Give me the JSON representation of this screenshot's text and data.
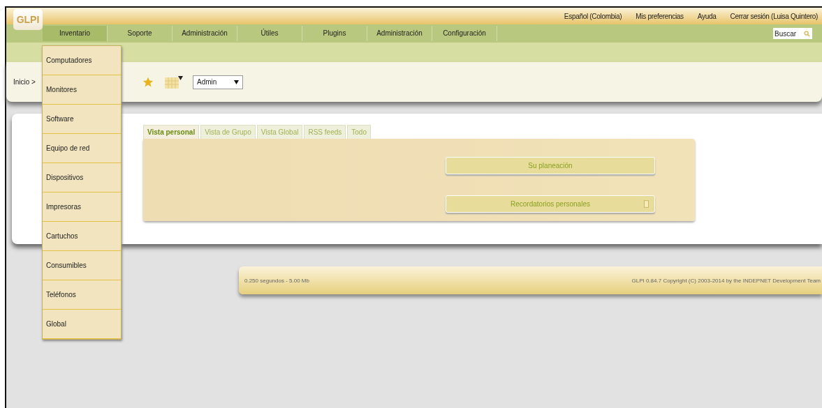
{
  "header": {
    "logo": "GLPI",
    "top_links": [
      "Español (Colombia)",
      "Mis preferencias",
      "Ayuda",
      "Cerrar sesión (Luisa Quintero)"
    ],
    "search": {
      "placeholder": "Buscar"
    }
  },
  "nav": [
    {
      "label": "Inventario",
      "selected": true
    },
    {
      "label": "Soporte",
      "selected": false
    },
    {
      "label": "Administración",
      "selected": false
    },
    {
      "label": "Útiles",
      "selected": false
    },
    {
      "label": "Plugins",
      "selected": false
    },
    {
      "label": "Administración",
      "selected": false
    },
    {
      "label": "Configuración",
      "selected": false
    }
  ],
  "menu": [
    "Computadores",
    "Monitores",
    "Software",
    "Equipo de red",
    "Dispositivos",
    "Impresoras",
    "Cartuchos",
    "Consumibles",
    "Teléfonos",
    "Global"
  ],
  "breadcrumb": "Inicio >",
  "profile_select": {
    "value": "Admin"
  },
  "tabs": [
    {
      "label": "Vista personal",
      "selected": true
    },
    {
      "label": "Vista de Grupo",
      "selected": false
    },
    {
      "label": "Vista Global",
      "selected": false
    },
    {
      "label": "RSS feeds",
      "selected": false
    },
    {
      "label": "Todo",
      "selected": false
    }
  ],
  "panel_buttons": [
    {
      "label": "Su planeación",
      "kind": "plain"
    },
    {
      "label": "Recordatorios personales",
      "kind": "add"
    }
  ],
  "footer": {
    "left": "0.250 segundos - 5.00 Mb",
    "right": "GLPI 0.84.7 Copyright (C) 2003-2014 by the INDEPNET Development Team"
  }
}
